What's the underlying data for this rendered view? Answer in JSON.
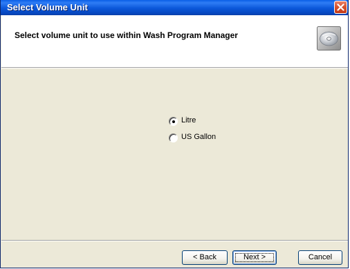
{
  "window": {
    "title": "Select Volume Unit"
  },
  "header": {
    "heading": "Select volume unit to use within Wash Program Manager",
    "icon": "cd-disc-icon"
  },
  "options": [
    {
      "label": "Litre",
      "selected": true
    },
    {
      "label": "US Gallon",
      "selected": false
    }
  ],
  "buttons": {
    "back": "< Back",
    "next": "Next >",
    "cancel": "Cancel"
  },
  "colors": {
    "titlebar": "#0B57D9",
    "close": "#D9542F",
    "dialog_bg": "#ECE9D8"
  }
}
